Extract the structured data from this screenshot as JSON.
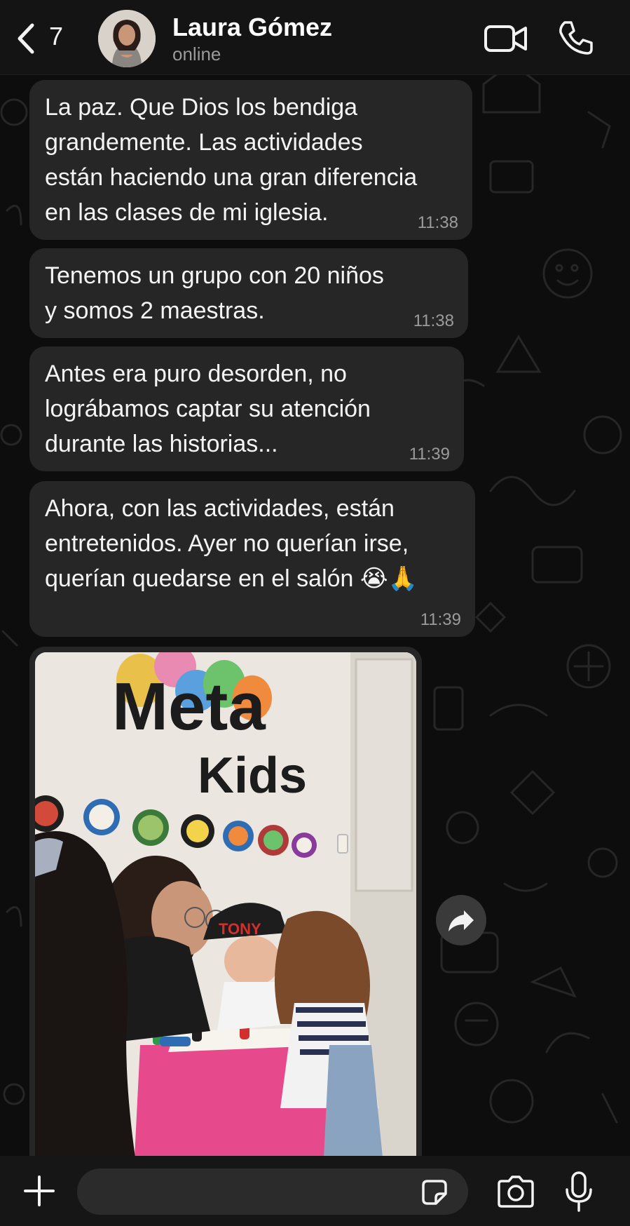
{
  "header": {
    "back_count": "7",
    "contact_name": "Laura Gómez",
    "contact_status": "online"
  },
  "messages": [
    {
      "text": "La paz. Que Dios los bendiga\ngrandemente. Las actividades\nestán haciendo una gran diferencia\nen las clases de mi iglesia.",
      "time": "11:38"
    },
    {
      "text": "Tenemos un grupo con 20 niños\ny somos  2 maestras.",
      "time": "11:38"
    },
    {
      "text": "Antes era puro desorden, no\nlográbamos captar su atención\ndurante las historias...",
      "time": "11:39"
    },
    {
      "text": "Ahora, con las actividades, están\nentretenidos. Ayer no querían irse,\nquerían quedarse en el salón 😭🙏",
      "time": "11:39"
    }
  ],
  "photo": {
    "wall_sign_line1": "Meta",
    "wall_sign_line2": "Kids",
    "cap_text": "TONY"
  },
  "composer": {
    "placeholder": ""
  },
  "colors": {
    "bubble": "#262626",
    "background": "#0b0b0b",
    "header": "#141414"
  },
  "icons": [
    "back-chevron-icon",
    "video-call-icon",
    "phone-icon",
    "forward-icon",
    "plus-icon",
    "sticker-icon",
    "camera-icon",
    "microphone-icon"
  ]
}
